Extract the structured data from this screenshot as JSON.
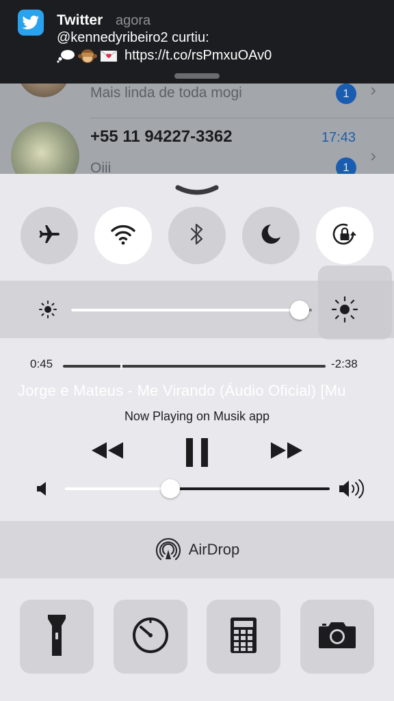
{
  "background_messages": [
    {
      "preview": "Mais linda de toda mogi",
      "badge": "1"
    },
    {
      "name": "+55 11 94227-3362",
      "preview": "Oiii",
      "time": "17:43",
      "badge": "1"
    }
  ],
  "notification": {
    "app_name": "Twitter",
    "time": "agora",
    "line1": "@kennedyribeiro2 curtiu:",
    "link": "https://t.co/rsPmxuOAv0",
    "app_icon": "twitter-bird-icon",
    "emojis": [
      "thought-balloon-emoji",
      "see-no-evil-monkey-emoji",
      "love-letter-emoji"
    ]
  },
  "control_center": {
    "toggles": [
      {
        "name": "airplane-mode",
        "icon": "airplane-icon",
        "on": false
      },
      {
        "name": "wifi",
        "icon": "wifi-icon",
        "on": true
      },
      {
        "name": "bluetooth",
        "icon": "bluetooth-icon",
        "on": false
      },
      {
        "name": "do-not-disturb",
        "icon": "moon-icon",
        "on": false
      },
      {
        "name": "rotation-lock",
        "icon": "rotation-lock-icon",
        "on": true
      }
    ],
    "brightness_level": 0.95,
    "music": {
      "elapsed": "0:45",
      "remaining": "-2:38",
      "progress": 0.22,
      "title": "Jorge e Mateus - Me Virando (Áudio Oficial) [Mu",
      "source": "Now Playing on Musik app",
      "volume_level": 0.4,
      "state": "playing"
    },
    "airdrop_label": "AirDrop",
    "shortcuts": [
      {
        "name": "flashlight",
        "icon": "flashlight-icon"
      },
      {
        "name": "timer",
        "icon": "timer-icon"
      },
      {
        "name": "calculator",
        "icon": "calculator-icon"
      },
      {
        "name": "camera",
        "icon": "camera-icon"
      }
    ],
    "colors": {
      "background": "#e9e9ed",
      "toggle_off": "#d0d0d5",
      "toggle_on": "#ffffff",
      "accent_twitter": "#2aa3ef",
      "badge": "#1a5db0"
    }
  }
}
